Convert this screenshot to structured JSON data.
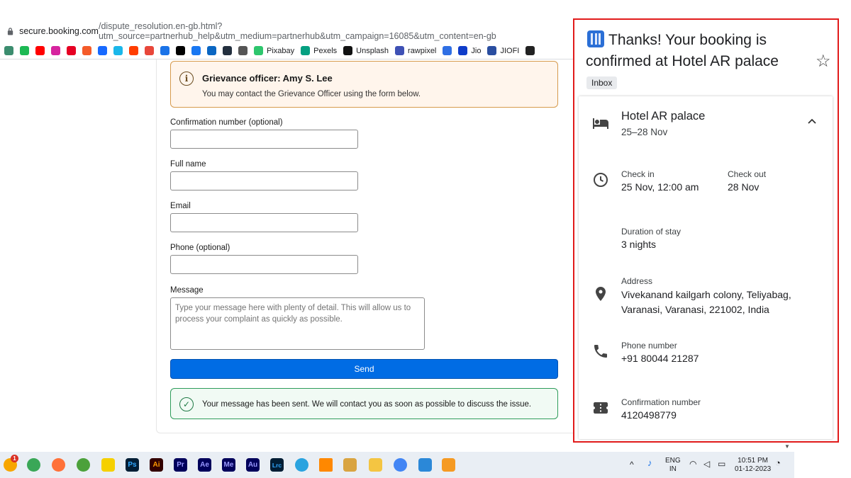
{
  "browser": {
    "url_host": "secure.booking.com",
    "url_rest": "/dispute_resolution.en-gb.html?utm_source=partnerhub_help&utm_medium=partnerhub&utm_campaign=16085&utm_content=en-gb",
    "bookmarks": [
      {
        "label": "",
        "color": "#3c8d6f"
      },
      {
        "label": "",
        "color": "#1db954"
      },
      {
        "label": "",
        "color": "#ff0000"
      },
      {
        "label": "",
        "color": "#d6249f"
      },
      {
        "label": "",
        "color": "#e60023"
      },
      {
        "label": "",
        "color": "#f45b2a"
      },
      {
        "label": "",
        "color": "#1769ff"
      },
      {
        "label": "",
        "color": "#1ab7ea"
      },
      {
        "label": "",
        "color": "#ff3d00"
      },
      {
        "label": "",
        "color": "#e8473a"
      },
      {
        "label": "",
        "color": "#1a73e8"
      },
      {
        "label": "",
        "color": "#000000"
      },
      {
        "label": "",
        "color": "#1877f2"
      },
      {
        "label": "",
        "color": "#0a66c2"
      },
      {
        "label": "",
        "color": "#232f3e"
      },
      {
        "label": "",
        "color": "#555555"
      },
      {
        "label": "Pixabay",
        "color": "#2ec66d"
      },
      {
        "label": "Pexels",
        "color": "#05a081"
      },
      {
        "label": "Unsplash",
        "color": "#111111"
      },
      {
        "label": "rawpixel",
        "color": "#3f51b5"
      },
      {
        "label": "",
        "color": "#2f6fe4"
      },
      {
        "label": "Jio",
        "color": "#0f3cc9"
      },
      {
        "label": "JIOFI",
        "color": "#2a4ea0"
      },
      {
        "label": "",
        "color": "#222222"
      }
    ]
  },
  "form": {
    "grievance_title": "Grievance officer: Amy S. Lee",
    "grievance_desc": "You may contact the Grievance Officer using the form below.",
    "confirmation_label": "Confirmation number (optional)",
    "fullname_label": "Full name",
    "email_label": "Email",
    "phone_label": "Phone (optional)",
    "message_label": "Message",
    "message_placeholder": "Type your message here with plenty of detail. This will allow us to process your complaint as quickly as possible.",
    "send_label": "Send",
    "success_text": "Your message has been sent. We will contact you as soon as possible to discuss the issue."
  },
  "email_panel": {
    "title": "Thanks! Your booking is confirmed at Hotel AR palace",
    "label_chip": "Inbox",
    "hotel_name": "Hotel AR palace",
    "dates": "25–28 Nov",
    "checkin_label": "Check in",
    "checkin_value": "25 Nov, 12:00 am",
    "checkout_label": "Check out",
    "checkout_value": "28 Nov",
    "duration_label": "Duration of stay",
    "duration_value": "3 nights",
    "address_label": "Address",
    "address_value": "Vivekanand kailgarh colony, Teliyabag, Varanasi, Varanasi, 221002, India",
    "phone_label": "Phone number",
    "phone_value": "+91 80044 21287",
    "confirmation_label": "Confirmation number",
    "confirmation_value": "4120498779"
  },
  "taskbar": {
    "apps": [
      "Ps",
      "Ai",
      "Pr",
      "Ae",
      "Me",
      "Au",
      "Lrc"
    ],
    "language_top": "ENG",
    "language_bottom": "IN",
    "time": "10:51 PM",
    "date": "01-12-2023",
    "notification_badge": "1"
  }
}
